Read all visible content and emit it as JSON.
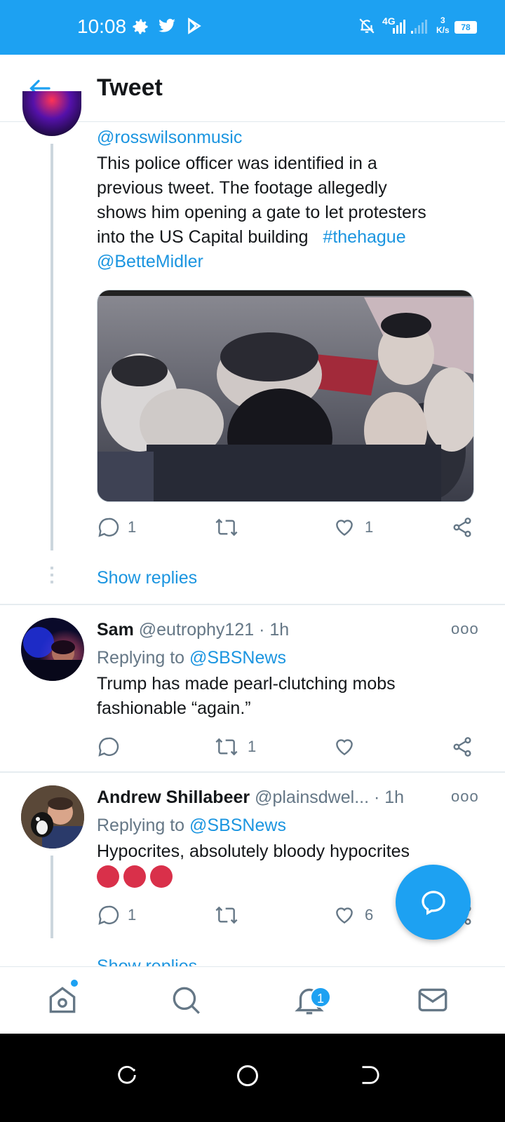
{
  "status_bar": {
    "time": "10:08",
    "network": "4G",
    "speed": "3\nK/s",
    "battery": "78"
  },
  "header": {
    "title": "Tweet"
  },
  "tweets": [
    {
      "handle": "@rosswilsonmusic",
      "text_line1": "This police officer was identified in a",
      "text_line2": "previous tweet. The footage allegedly",
      "text_line3": "shows him opening a gate to let protesters",
      "text_line4_a": "into the US Capital building",
      "hashtag": "#thehague",
      "mention": "@BetteMidler",
      "replies": "1",
      "retweets": "",
      "likes": "1",
      "show_replies": "Show replies"
    },
    {
      "name": "Sam",
      "handle": "@eutrophy121",
      "time": "· 1h",
      "replying_label": "Replying to",
      "replying_to": "@SBSNews",
      "text_line1": "Trump has made pearl-clutching mobs",
      "text_line2": "fashionable “again.”",
      "replies": "",
      "retweets": "1",
      "likes": ""
    },
    {
      "name": "Andrew Shillabeer",
      "handle": "@plainsdwel...",
      "time": "· 1h",
      "replying_label": "Replying to",
      "replying_to": "@SBSNews",
      "text_line1": "Hypocrites,  absolutely bloody hypocrites",
      "replies": "1",
      "retweets": "",
      "likes": "6",
      "show_replies": "Show replies"
    }
  ],
  "bottom_nav": {
    "notifications_badge": "1"
  },
  "colors": {
    "brand": "#1da1f2",
    "link": "#1b95e0",
    "muted": "#657786"
  }
}
